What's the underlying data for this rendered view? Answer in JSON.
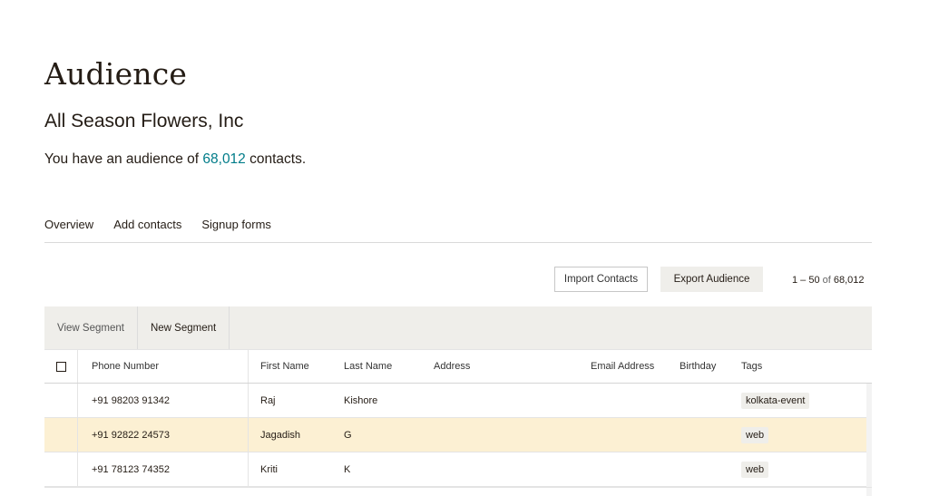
{
  "page": {
    "title": "Audience",
    "org_name": "All Season Flowers, Inc",
    "summary_prefix": "You have an audience of ",
    "summary_count": "68,012",
    "summary_suffix": " contacts."
  },
  "tabs": [
    {
      "label": "Overview"
    },
    {
      "label": "Add contacts"
    },
    {
      "label": "Signup forms"
    }
  ],
  "toolbar": {
    "import_label": "Import Contacts",
    "export_label": "Export Audience",
    "pager_range": "1 – 50",
    "pager_of": " of ",
    "pager_total": "68,012"
  },
  "segments": {
    "view_label": "View Segment",
    "new_label": "New Segment"
  },
  "table": {
    "headers": {
      "phone": "Phone Number",
      "first": "First Name",
      "last": "Last Name",
      "address": "Address",
      "email": "Email Address",
      "birthday": "Birthday",
      "tags": "Tags"
    },
    "rows": [
      {
        "phone": "+91 98203 91342",
        "first": "Raj",
        "last": "Kishore",
        "tag": "kolkata-event"
      },
      {
        "phone": "+91 92822 24573",
        "first": "Jagadish",
        "last": "G",
        "tag": "web"
      },
      {
        "phone": "+91 78123 74352",
        "first": "Kriti",
        "last": "K",
        "tag": "web"
      }
    ]
  },
  "colors": {
    "link": "#007c89",
    "highlight_row": "#fcf0d3",
    "toolbar_bg": "#efeeea"
  }
}
